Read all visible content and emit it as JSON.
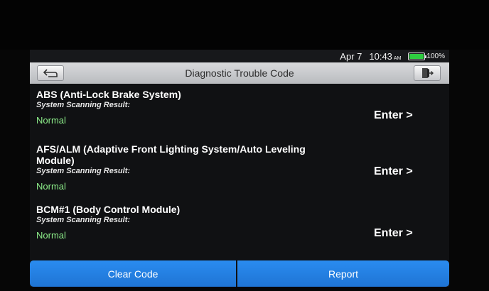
{
  "status_bar": {
    "date": "Apr 7",
    "time": "10:43",
    "ampm": "AM",
    "battery": "100%",
    "battery_level": 1.0,
    "battery_color": "#2ecc40"
  },
  "header": {
    "title": "Diagnostic Trouble Code",
    "back_icon": "back-arrow-icon",
    "exit_icon": "exit-door-icon"
  },
  "systems": [
    {
      "name": "ABS (Anti-Lock Brake System)",
      "result_label": "System Scanning Result:",
      "result": "Normal",
      "action": "Enter >"
    },
    {
      "name_line1": "AFS/ALM (Adaptive Front Lighting System/Auto Leveling",
      "name_line2": "Module)",
      "result_label": "System Scanning Result:",
      "result": "Normal",
      "action": "Enter >"
    },
    {
      "name": "BCM#1 (Body Control Module)",
      "result_label": "System Scanning Result:",
      "result": "Normal",
      "action": "Enter >"
    }
  ],
  "footer": {
    "clear_label": "Clear Code",
    "report_label": "Report",
    "button_color": "#2a8cf0"
  },
  "colors": {
    "normal_status": "#8ef08b",
    "background": "#101113"
  }
}
